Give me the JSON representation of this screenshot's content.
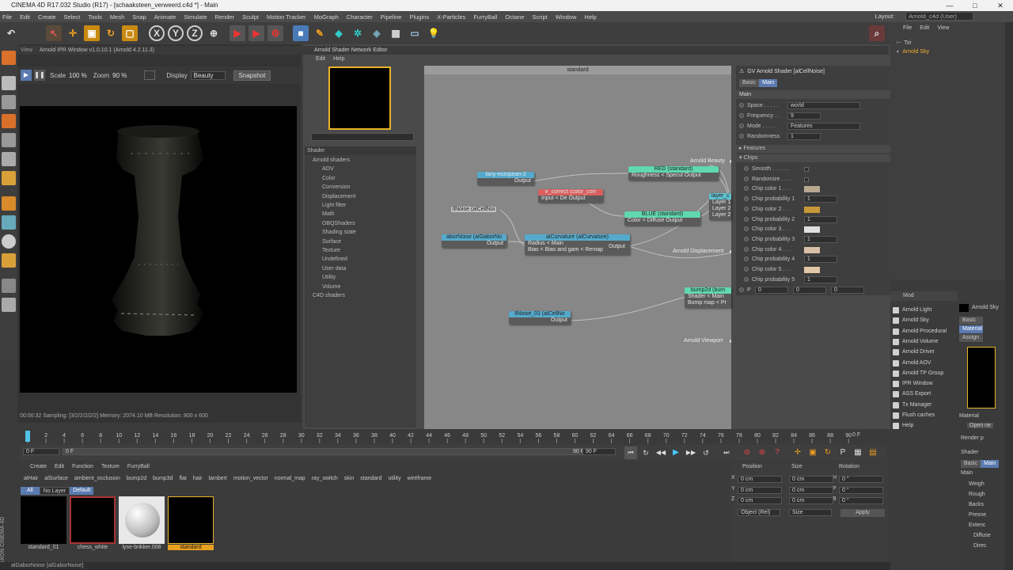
{
  "window": {
    "title": "CINEMA 4D R17.032 Studio (R17) - [schaaksteen_verweerd.c4d *] - Main",
    "controls": [
      "—",
      "□",
      "✕"
    ]
  },
  "menu": {
    "items": [
      "File",
      "Edit",
      "Create",
      "Select",
      "Tools",
      "Mesh",
      "Snap",
      "Animate",
      "Simulate",
      "Render",
      "Sculpt",
      "Motion Tracker",
      "MoGraph",
      "Character",
      "Pipeline",
      "Plugins",
      "X-Particles",
      "FurryBall",
      "Octane",
      "Script",
      "Window",
      "Help"
    ],
    "layout_label": "Layout:",
    "layout_value": "Arnold_c4d (User)"
  },
  "ipr": {
    "tab": "View",
    "title": "Arnold IPR Window v1.0.10.1 (Arnold 4.2.11.3)",
    "scale_label": "Scale",
    "scale_value": "100 %",
    "zoom_label": "Zoom",
    "zoom_value": "90 %",
    "display_label": "Display",
    "display_value": "Beauty",
    "snapshot": "Snapshot",
    "status": "00:00:32  Sampling: [3/2/2/2/2/2]  Memory: 2074.10 MB  Resolution: 800 x 600"
  },
  "sne": {
    "title": "Arnold Shader Network Editor",
    "menu": [
      "Edit",
      "Help"
    ],
    "shader_header": "Shader",
    "canvas_title": "standard",
    "tree": [
      {
        "label": "Arnold shaders",
        "level": 0,
        "color": ""
      },
      {
        "label": "AOV",
        "level": 1,
        "color": "#f2f2f2"
      },
      {
        "label": "Color",
        "level": 1,
        "color": "#e08080"
      },
      {
        "label": "Conversion",
        "level": 1,
        "color": "#f0d0c0"
      },
      {
        "label": "Displacement",
        "level": 1,
        "color": "#f0c8a0"
      },
      {
        "label": "Light filter",
        "level": 1,
        "color": "#f5f0b0"
      },
      {
        "label": "Math",
        "level": 1,
        "color": "#f0f0d0"
      },
      {
        "label": "OBQShaders",
        "level": 1,
        "color": "#222222"
      },
      {
        "label": "Shading state",
        "level": 1,
        "color": "#78c878"
      },
      {
        "label": "Surface",
        "level": 1,
        "color": "#70d8b0"
      },
      {
        "label": "Texture",
        "level": 1,
        "color": "#60b8c0"
      },
      {
        "label": "Undefined",
        "level": 1,
        "color": "#888888"
      },
      {
        "label": "User data",
        "level": 1,
        "color": "#e0b0d0"
      },
      {
        "label": "Utility",
        "level": 1,
        "color": "#d0d0f0"
      },
      {
        "label": "Volume",
        "level": 1,
        "color": "#6060c0"
      },
      {
        "label": "C4D shaders",
        "level": 0,
        "color": "#70d0c0"
      }
    ],
    "nodes": {
      "n1": {
        "title": "fany-european-2",
        "ports": [
          "Output"
        ]
      },
      "n2": {
        "title": "e_correct (color_corr",
        "ports": [
          "Input < De Output"
        ]
      },
      "n3": {
        "title": "RED (standard)",
        "ports": [
          "Roughness < Specul Output"
        ]
      },
      "n4": {
        "title": "BLUE (standard)",
        "ports": [
          "Color < Diffuse Output"
        ]
      },
      "n5": {
        "title": "layer_c",
        "ports": [
          "Layer 1",
          "Layer 2",
          "Layer 2"
        ]
      },
      "n6": {
        "title": "aborNoise (alGaborNo",
        "ports": [
          "Output"
        ]
      },
      "n7": {
        "title": "alCurvature (alCurvature)",
        "ports": [
          "Radius < Main",
          "Bias < Bias and gam < Remap"
        ],
        "extra": "Output"
      },
      "n8": {
        "title": "bump2d (bum",
        "ports": [
          "Shader < Main",
          "Bump map < Pr"
        ]
      },
      "n9": {
        "title": "llNoise_01 (alCellNo",
        "ports": [
          "Output"
        ]
      }
    },
    "float_labels": [
      "llNoise (alCellNoi",
      "Arnold Beauty",
      "Arnold Displacement",
      "Arnold Viewport"
    ]
  },
  "attr": {
    "header": "GV Arnold Shader [alCellNoise]",
    "tabs": [
      "Basic",
      "Main"
    ],
    "section": "Main",
    "rows": [
      {
        "label": "Space . . . . .",
        "value": "world",
        "type": "select"
      },
      {
        "label": "Frequency . .",
        "value": "9",
        "type": "num"
      },
      {
        "label": "Mode . . . . .",
        "value": "Features",
        "type": "select"
      },
      {
        "label": "Randomness",
        "value": "1",
        "type": "num"
      }
    ],
    "groups": [
      "Features",
      "Chips"
    ],
    "chips": [
      {
        "label": "Smooth . . . . . .",
        "type": "check",
        "value": ""
      },
      {
        "label": "Randomize . . . .",
        "type": "check",
        "value": ""
      },
      {
        "label": "Chip color 1 . . .",
        "type": "color",
        "value": "#b8a890"
      },
      {
        "label": "Chip probability 1",
        "type": "num",
        "value": "1"
      },
      {
        "label": "Chip color 2 . . .",
        "type": "color",
        "value": "#c89838"
      },
      {
        "label": "Chip probability 2",
        "type": "num",
        "value": "1"
      },
      {
        "label": "Chip color 3 . . .",
        "type": "color",
        "value": "#e0e0e0"
      },
      {
        "label": "Chip probability 3",
        "type": "num",
        "value": "1"
      },
      {
        "label": "Chip color 4 . . .",
        "type": "color",
        "value": "#d8c0a8"
      },
      {
        "label": "Chip probability 4",
        "type": "num",
        "value": "1"
      },
      {
        "label": "Chip color 5 . . .",
        "type": "color",
        "value": "#e0c8a8"
      },
      {
        "label": "Chip probability 5",
        "type": "num",
        "value": "1"
      }
    ],
    "p_label": "P",
    "p_values": [
      "0",
      "0",
      "0"
    ]
  },
  "objmgr": {
    "menu": [
      "File",
      "Edit",
      "View"
    ],
    "objects": [
      "Tiri",
      "Arnold Sky"
    ]
  },
  "modmenu": {
    "header": "Mod",
    "items": [
      "Arnold Light",
      "Arnold Sky",
      "Arnold Procedural",
      "Arnold Volume",
      "Arnold Driver",
      "Arnold AOV",
      "Arnold TP Group",
      "IPR Window",
      "ASS Export",
      "Tx Manager",
      "Flush caches",
      "Help"
    ]
  },
  "matattr": {
    "name": "Arnold Sky",
    "tabs": [
      "Basic",
      "Material",
      "Assign"
    ],
    "material_label": "Material",
    "open_btn": "Open ne",
    "render_label": "Render p",
    "shader_label": "Shader",
    "tabs2": [
      "Basic",
      "Main"
    ],
    "main": "Main",
    "rows": [
      "Weigh",
      "Rough",
      "Backs",
      "Presne",
      "Extenc",
      "Diffuse",
      "Direc"
    ]
  },
  "timeline": {
    "ticks": [
      "0",
      "2",
      "4",
      "6",
      "8",
      "10",
      "12",
      "14",
      "16",
      "18",
      "20",
      "22",
      "24",
      "26",
      "28",
      "30",
      "32",
      "34",
      "36",
      "38",
      "40",
      "42",
      "44",
      "46",
      "48",
      "50",
      "52",
      "54",
      "56",
      "58",
      "60",
      "62",
      "64",
      "66",
      "68",
      "70",
      "72",
      "74",
      "76",
      "78",
      "80",
      "82",
      "84",
      "86",
      "88",
      "90"
    ],
    "end_label": "0 F",
    "start_field": "0 F",
    "start2": "0 F",
    "end_field1": "90 F",
    "end_field2": "90 F"
  },
  "matmgr": {
    "menu": [
      "Create",
      "Edit",
      "Function",
      "Texture",
      "FurryBall"
    ],
    "filters": [
      "alHair",
      "alSurface",
      "ambient_occlusion",
      "bump2d",
      "bump3d",
      "flat",
      "hair",
      "lambert",
      "motion_vector",
      "normal_map",
      "ray_switch",
      "skin",
      "standard",
      "utility",
      "wireframe"
    ],
    "layer_tabs": [
      "All",
      "No Layer",
      "Default"
    ],
    "materials": [
      {
        "name": "standard_01",
        "kind": "black"
      },
      {
        "name": "chess_white",
        "kind": "black-red"
      },
      {
        "name": "lyse-brikker.008",
        "kind": "sphere"
      },
      {
        "name": "standard",
        "kind": "black-selected"
      }
    ]
  },
  "coords": {
    "headers": [
      "Position",
      "Size",
      "Rotation"
    ],
    "rows": [
      {
        "axis": "X",
        "pos": "0 cm",
        "size": "0 cm",
        "rot_axis": "H",
        "rot": "0 °"
      },
      {
        "axis": "Y",
        "pos": "0 cm",
        "size": "0 cm",
        "rot_axis": "P",
        "rot": "0 °"
      },
      {
        "axis": "Z",
        "pos": "0 cm",
        "size": "0 cm",
        "rot_axis": "B",
        "rot": "0 °"
      }
    ],
    "mode": "Object (Rel)",
    "size_mode": "Size",
    "apply": "Apply"
  },
  "statusbar": {
    "text": "alGaborNoise [alGaborNoise]"
  },
  "maxon": "MAXON CINEMA 4D"
}
